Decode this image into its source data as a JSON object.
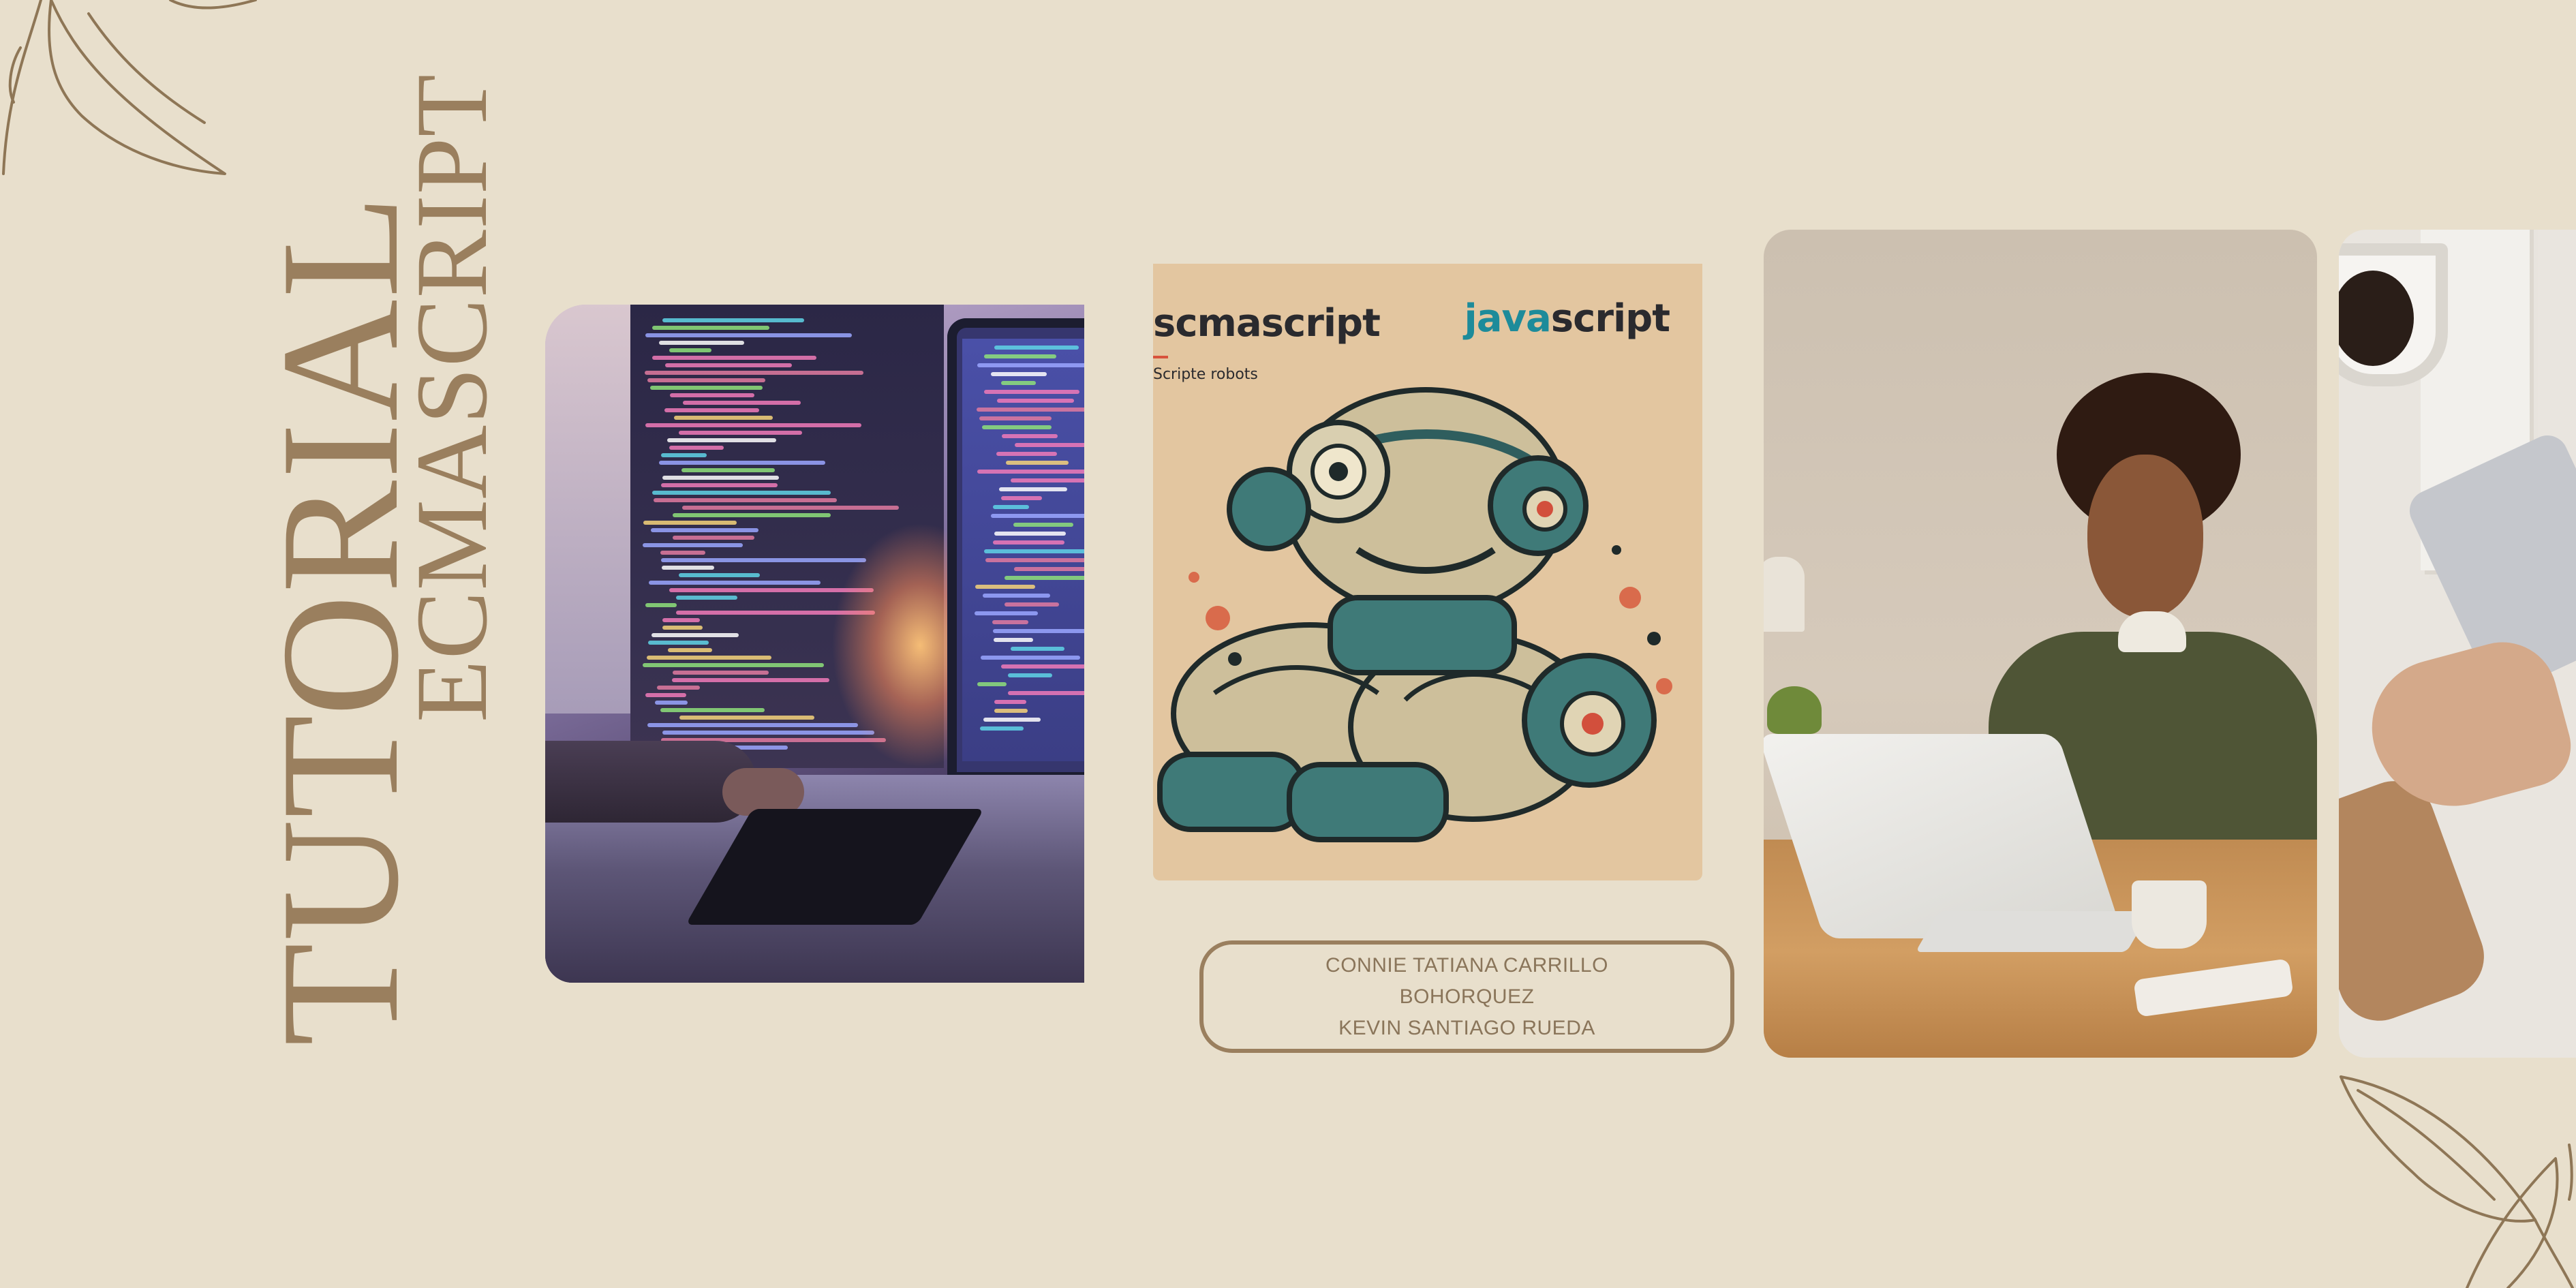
{
  "title": {
    "main": "TUTORIAL",
    "sub": "ECMASCRIPT"
  },
  "robot_card": {
    "left_word": "scmascript",
    "sub_word": "Scripte robots",
    "right_word_accent": "java",
    "right_word_rest": "script"
  },
  "credits": {
    "line1": "CONNIE TATIANA CARRILLO",
    "line2": "BOHORQUEZ",
    "line3": "KEVIN SANTIAGO RUEDA"
  },
  "colors": {
    "background": "#e8dfcc",
    "accent_brown": "#9a7f5e",
    "javascript_teal": "#1d8b9a"
  },
  "icons": [
    "leaf-outline-top-left",
    "leaf-outline-bottom-right"
  ]
}
